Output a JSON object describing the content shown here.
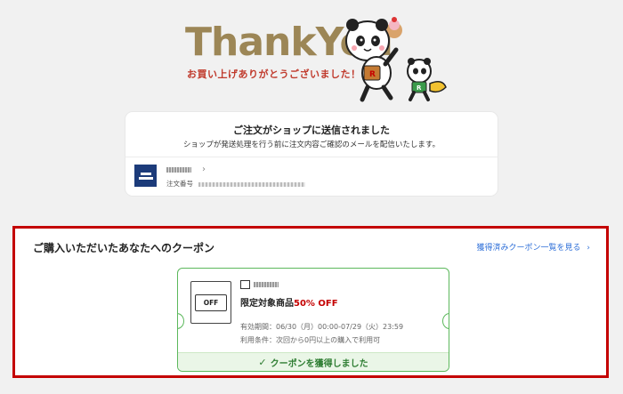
{
  "hero": {
    "title": "ThankYou",
    "subtitle": "お買い上げありがとうございました！"
  },
  "order": {
    "heading": "ご注文がショップに送信されました",
    "description": "ショップが発送処理を行う前に注文内容ご確認のメールを配信いたします。",
    "order_number_label": "注文番号",
    "chevron": "›"
  },
  "coupon_section": {
    "heading": "ご購入いただいたあなたへのクーポン",
    "link": "獲得済みクーポン一覧を見る",
    "link_chevron": "›",
    "coupon": {
      "icon_text": "OFF",
      "title_prefix": "限定対象商品",
      "discount": "50% OFF",
      "validity": "有効期間：06/30（月）00:00-07/29（火）23:59",
      "condition": "利用条件：次回から0円以上の購入で利用可",
      "status": "クーポンを獲得しました",
      "status_check": "✓"
    }
  },
  "colors": {
    "accent_red": "#c40000",
    "success_green": "#5cb85c",
    "link_blue": "#2e6fd8",
    "title_gold": "#9c8656"
  }
}
